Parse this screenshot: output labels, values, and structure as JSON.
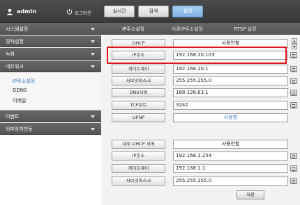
{
  "header": {
    "user": "admin",
    "logout_label": "로그아웃"
  },
  "main_tabs": [
    {
      "label": "실시간"
    },
    {
      "label": "검색"
    },
    {
      "label": "설정"
    }
  ],
  "sub_tabs": [
    {
      "label": "IP주소설정"
    },
    {
      "label": "다중IP주소설정"
    },
    {
      "label": "RTSP 설정"
    }
  ],
  "sidebar": {
    "menus": [
      {
        "label": "시스템설정"
      },
      {
        "label": "경차설정"
      },
      {
        "label": "녹화"
      },
      {
        "label": "네트워크"
      },
      {
        "label": "이벤트"
      },
      {
        "label": "외부장치연동"
      }
    ],
    "submenu": [
      {
        "label": "IP주소설정"
      },
      {
        "label": "DDNS"
      },
      {
        "label": "이메일"
      }
    ]
  },
  "form": {
    "dhcp": {
      "label": "DHCP",
      "value": "사용안함"
    },
    "ip": {
      "label": "IP주소",
      "value": "192.168.10.103"
    },
    "gateway": {
      "label": "게이트웨이",
      "value": "192.168.10.1"
    },
    "subnet": {
      "label": "서브넷마스크",
      "value": "255.255.255.0"
    },
    "dns": {
      "label": "DNS서버",
      "value": "168.126.63.1"
    },
    "tcp_port": {
      "label": "TCP포트",
      "value": "3242"
    },
    "upnp": {
      "label": "UPNP",
      "value": "사용함"
    },
    "internal_dhcp": {
      "label": "내부 DHCP 서버",
      "value": "사용안함"
    },
    "internal_ip": {
      "label": "IP주소",
      "value": "192.168.1.254"
    },
    "internal_gateway": {
      "label": "게이트웨이",
      "value": "192.168.1.1"
    },
    "internal_subnet": {
      "label": "서브넷마스크",
      "value": "255.255.255.0"
    }
  },
  "save_label": "저장",
  "colors": {
    "active_tab": "#8fbfea",
    "link_blue": "#3a73c8",
    "highlight_red": "#e0121a"
  }
}
